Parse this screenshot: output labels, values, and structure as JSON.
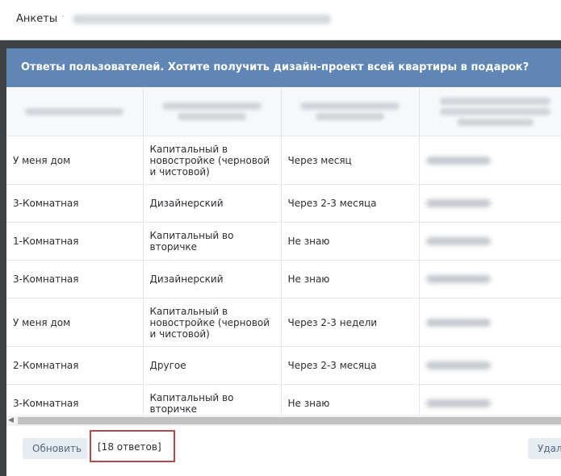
{
  "topbar": {
    "crumb": "Анкеты",
    "separator": "·"
  },
  "modal": {
    "title": "Ответы пользователей. Хотите получить дизайн-проект всей квартиры в подарок?",
    "rows": [
      {
        "c1": "У меня дом",
        "c2": "Капитальный в новостройке (черновой и чистовой)",
        "c3": "Через месяц"
      },
      {
        "c1": "3-Комнатная",
        "c2": "Дизайнерский",
        "c3": "Через 2-3 месяца"
      },
      {
        "c1": "1-Комнатная",
        "c2": "Капитальный во вторичке",
        "c3": "Не знаю"
      },
      {
        "c1": "3-Комнатная",
        "c2": "Дизайнерский",
        "c3": "Не знаю"
      },
      {
        "c1": "У меня дом",
        "c2": "Капитальный в новостройке (черновой и чистовой)",
        "c3": "Через 2-3 недели"
      },
      {
        "c1": "2-Комнатная",
        "c2": "Другое",
        "c3": "Через 2-3 месяца"
      },
      {
        "c1": "3-Комнатная",
        "c2": "Капитальный во вторичке",
        "c3": "Не знаю"
      }
    ]
  },
  "footer": {
    "refresh_label": "Обновить",
    "count_label": "[18 ответов]",
    "delete_label": "Удал"
  },
  "colors": {
    "header": "#5f86b4",
    "highlight_border": "#b54a4a"
  }
}
